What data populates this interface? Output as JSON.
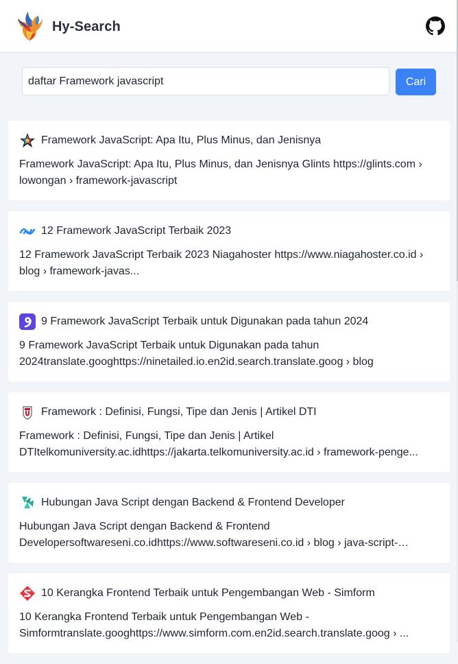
{
  "header": {
    "brand": "Hy-Search",
    "logo_icon": "phoenix-logo-icon",
    "github_icon": "github-icon"
  },
  "search": {
    "value": "daftar Framework javascript",
    "placeholder": "",
    "button_label": "Cari"
  },
  "colors": {
    "accent": "#3b82f6",
    "background": "#f1f4f9",
    "card": "#ffffff"
  },
  "results": [
    {
      "favicon": "glints-favicon-icon",
      "title": "Framework JavaScript: Apa Itu, Plus Minus, dan Jenisnya",
      "description": "Framework JavaScript: Apa Itu, Plus Minus, dan Jenisnya Glints https://glints.com › lowongan › framework-javascript"
    },
    {
      "favicon": "niagahoster-favicon-icon",
      "title": "12 Framework JavaScript Terbaik 2023",
      "description": "12 Framework JavaScript Terbaik 2023 Niagahoster https://www.niagahoster.co.id › blog › framework-javas..."
    },
    {
      "favicon": "ninetailed-favicon-icon",
      "title": "9 Framework JavaScript Terbaik untuk Digunakan pada tahun 2024",
      "description": "9 Framework JavaScript Terbaik untuk Digunakan pada tahun 2024translate.googhttps://ninetailed.io.en2id.search.translate.goog › blog"
    },
    {
      "favicon": "telkom-university-favicon-icon",
      "title": "Framework : Definisi, Fungsi, Tipe dan Jenis | Artikel DTI",
      "description": "Framework : Definisi, Fungsi, Tipe dan Jenis | Artikel DTItelkomuniversity.ac.idhttps://jakarta.telkomuniversity.ac.id › framework-penge..."
    },
    {
      "favicon": "softwareseni-favicon-icon",
      "title": "Hubungan Java Script dengan Backend & Frontend Developer",
      "description": "Hubungan Java Script dengan Backend & Frontend Developersoftwareseni.co.idhttps://www.softwareseni.co.id › blog › java-script-denga..."
    },
    {
      "favicon": "simform-favicon-icon",
      "title": "10 Kerangka Frontend Terbaik untuk Pengembangan Web - Simform",
      "description": "10 Kerangka Frontend Terbaik untuk Pengembangan Web - Simformtranslate.googhttps://www.simform.com.en2id.search.translate.goog › ..."
    }
  ]
}
